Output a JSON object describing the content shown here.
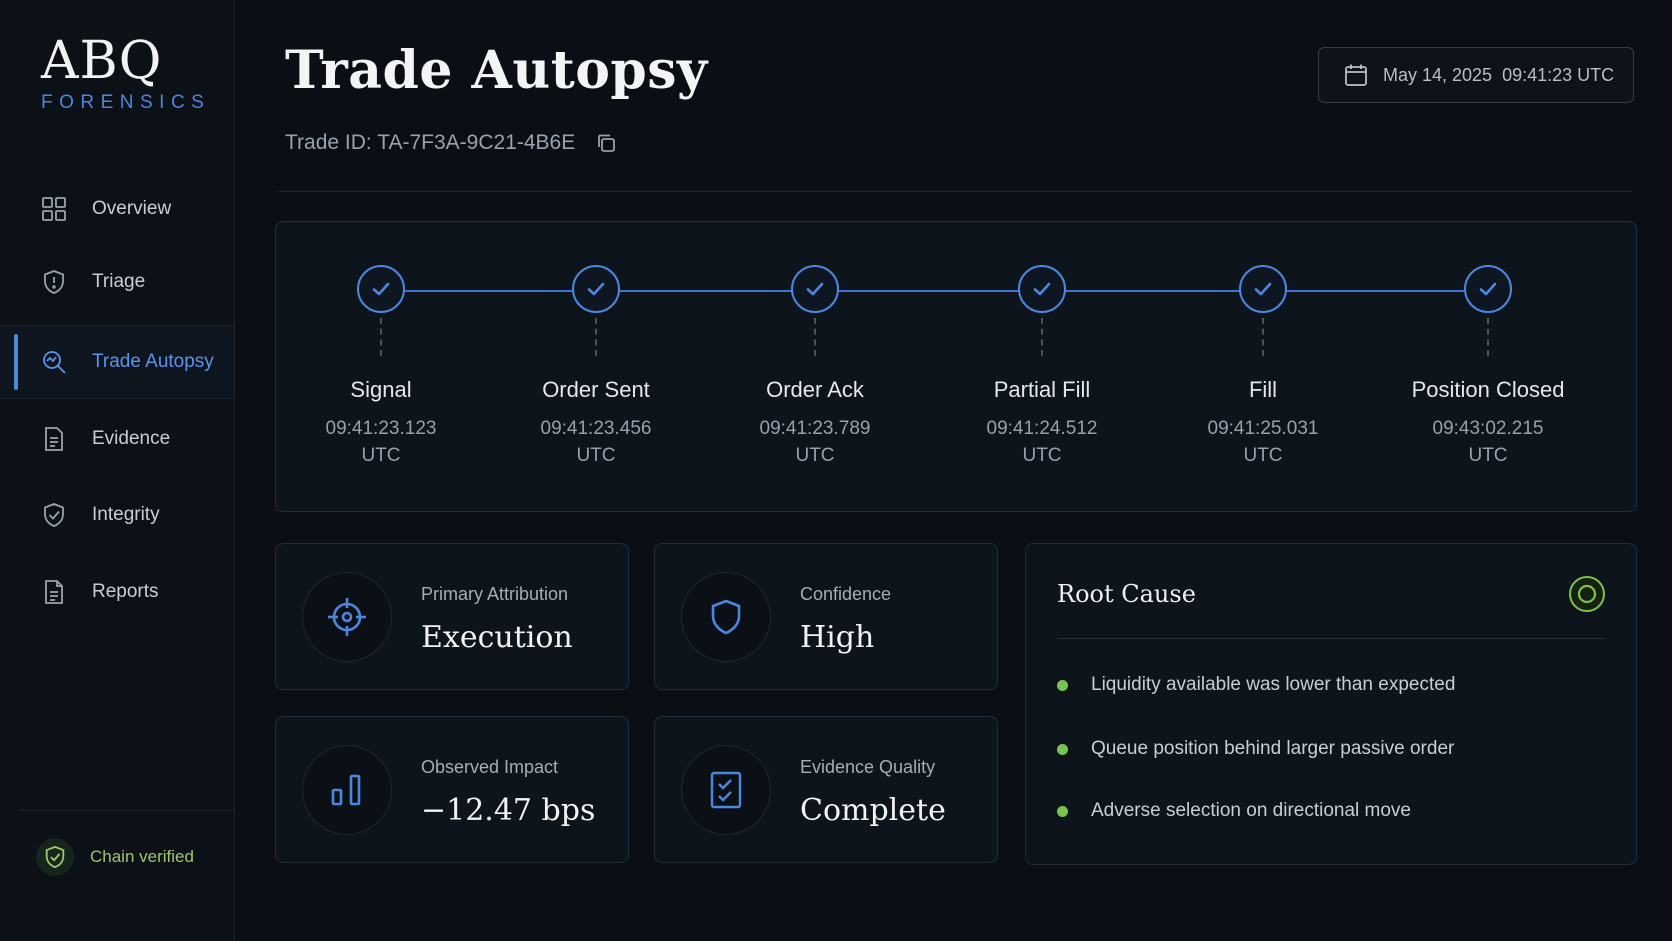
{
  "brand": {
    "name": "ABQ",
    "subtitle": "FORENSICS",
    "accent_color": "#4a88e0"
  },
  "sidebar": {
    "items": [
      {
        "label": "Overview",
        "icon": "grid-icon",
        "active": false
      },
      {
        "label": "Triage",
        "icon": "shield-alert-icon",
        "active": false
      },
      {
        "label": "Trade Autopsy",
        "icon": "magnify-analyze-icon",
        "active": true
      },
      {
        "label": "Evidence",
        "icon": "document-icon",
        "active": false
      },
      {
        "label": "Integrity",
        "icon": "shield-check-icon",
        "active": false
      },
      {
        "label": "Reports",
        "icon": "report-icon",
        "active": false
      }
    ],
    "footer": {
      "label": "Chain verified",
      "icon": "shield-check-icon",
      "color": "#9cc76a"
    }
  },
  "header": {
    "title": "Trade Autopsy",
    "trade_id": "Trade ID: TA-7F3A-9C21-4B6E",
    "date": "May 14, 2025",
    "time": "09:41:23 UTC",
    "date_display": "May 14, 2025  09:41:23 UTC"
  },
  "timeline": {
    "steps": [
      {
        "name": "Signal",
        "time": "09:41:23.123",
        "tz": "UTC",
        "status": "complete"
      },
      {
        "name": "Order Sent",
        "time": "09:41:23.456",
        "tz": "UTC",
        "status": "complete"
      },
      {
        "name": "Order Ack",
        "time": "09:41:23.789",
        "tz": "UTC",
        "status": "complete"
      },
      {
        "name": "Partial Fill",
        "time": "09:41:24.512",
        "tz": "UTC",
        "status": "complete"
      },
      {
        "name": "Fill",
        "time": "09:41:25.031",
        "tz": "UTC",
        "status": "complete"
      },
      {
        "name": "Position Closed",
        "time": "09:43:02.215",
        "tz": "UTC",
        "status": "complete"
      }
    ]
  },
  "cards": {
    "attribution": {
      "label": "Primary Attribution",
      "value": "Execution",
      "icon": "crosshair-icon"
    },
    "confidence": {
      "label": "Confidence",
      "value": "High",
      "icon": "shield-icon"
    },
    "impact": {
      "label": "Observed Impact",
      "value": "−12.47 bps",
      "icon": "bar-chart-icon"
    },
    "quality": {
      "label": "Evidence Quality",
      "value": "Complete",
      "icon": "checklist-icon"
    }
  },
  "root_cause": {
    "title": "Root Cause",
    "icon": "target-icon",
    "bullet_color": "#7bc34e",
    "items": [
      "Liquidity available was lower than expected",
      "Queue position behind larger passive order",
      "Adverse selection on directional move"
    ]
  }
}
